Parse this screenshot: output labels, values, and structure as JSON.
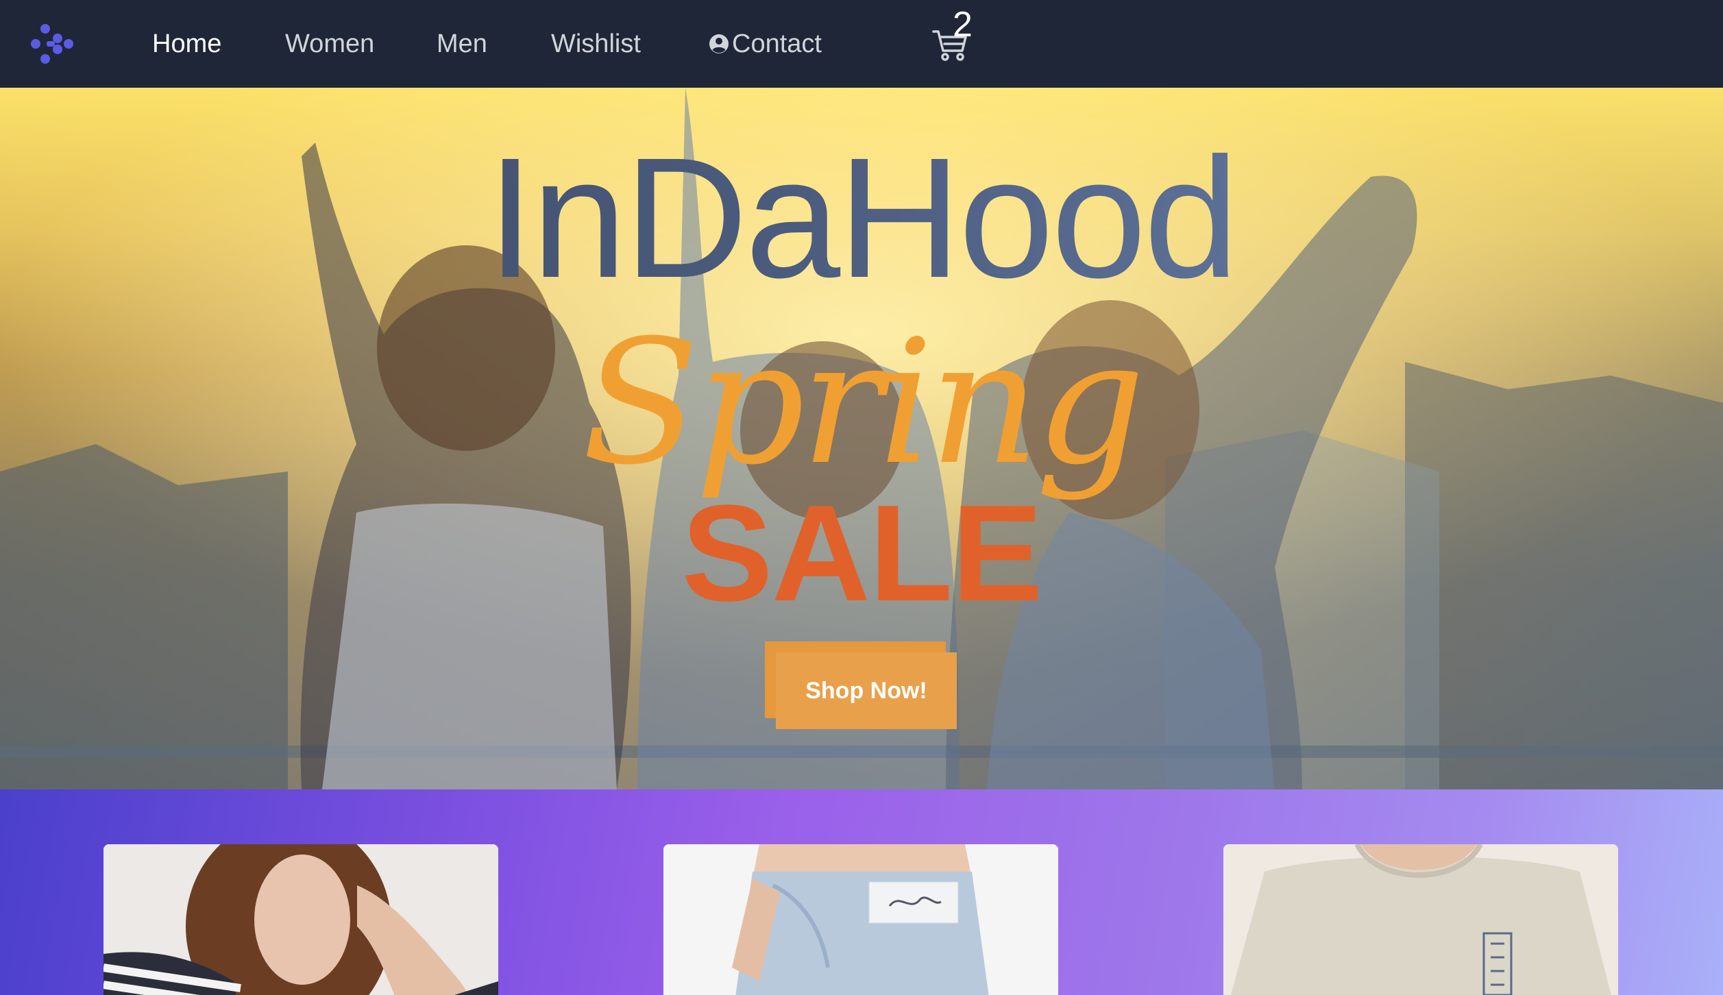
{
  "nav": {
    "links": [
      {
        "label": "Home",
        "active": true
      },
      {
        "label": "Women",
        "active": false
      },
      {
        "label": "Men",
        "active": false
      },
      {
        "label": "Wishlist",
        "active": false
      },
      {
        "label": "Contact",
        "active": false
      }
    ],
    "cart_count": "2",
    "icons": {
      "logo": "brand-logo-icon",
      "contact": "user-circle-icon",
      "cart": "shopping-cart-icon"
    }
  },
  "hero": {
    "brand": "InDaHood",
    "tagline_script": "Spring",
    "tagline_bold": "SALE",
    "cta_label": "Shop Now!"
  },
  "products": {
    "cards": [
      {
        "subject": "woman in striped top"
      },
      {
        "subject": "light wash jeans"
      },
      {
        "subject": "white graphic tee"
      }
    ]
  },
  "colors": {
    "nav_bg": "#1f2638",
    "logo": "#5b5be6",
    "brand_text": "#3c4962",
    "spring_text": "#f0a032",
    "sale_text": "#e0622a",
    "cta_bg": "#e8a14a",
    "products_bg_start": "#4a40cc",
    "products_bg_end": "#a9b0f8"
  }
}
